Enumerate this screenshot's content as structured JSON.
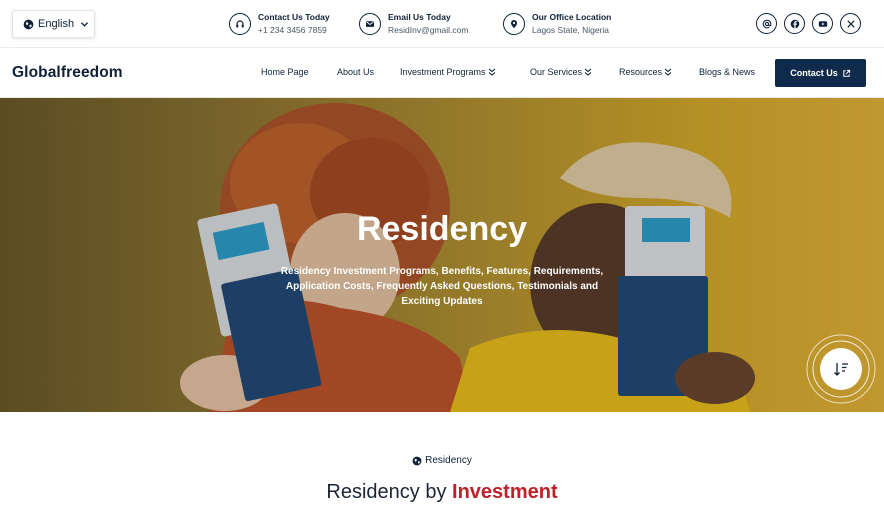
{
  "topbar": {
    "language": "English",
    "contact": {
      "title": "Contact Us Today",
      "value": "+1 234 3456 7859"
    },
    "email": {
      "title": "Email Us Today",
      "value": "ResidInv@gmail.com"
    },
    "office": {
      "title": "Our Office Location",
      "value": "Lagos State, Nigeria"
    },
    "social_icons": [
      "at-icon",
      "facebook-icon",
      "youtube-icon",
      "x-icon"
    ]
  },
  "nav": {
    "logo": "Globalfreedom",
    "items": [
      "Home Page",
      "About Us",
      "Investment Programs",
      "Our Services",
      "Resources",
      "Blogs & News"
    ],
    "contact_button": "Contact Us"
  },
  "hero": {
    "title": "Residency",
    "subtitle": "Residency Investment Programs, Benefits, Features, Requirements, Application Costs, Frequently Asked Questions, Testimonials and Exciting Updates"
  },
  "section": {
    "tag": "Residency",
    "title_prefix": "Residency by",
    "title_accent": "Investment"
  },
  "colors": {
    "navy": "#0f2a4a",
    "accent_red": "#c0202a",
    "hero_yellow": "#e6b63a"
  }
}
